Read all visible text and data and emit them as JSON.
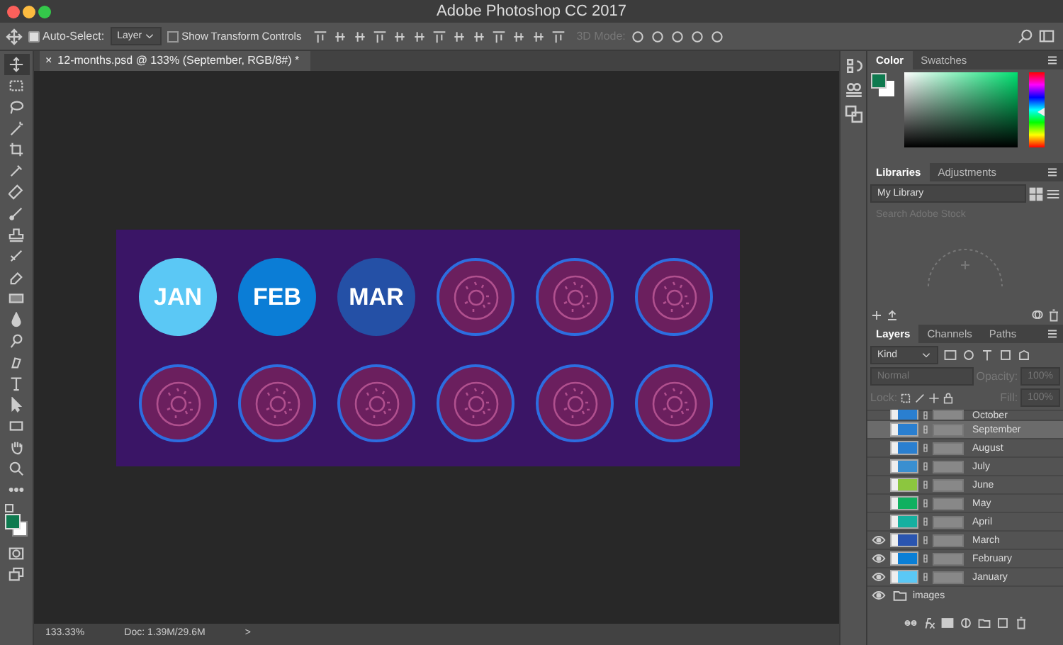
{
  "window": {
    "title": "Adobe Photoshop CC 2017"
  },
  "options_bar": {
    "auto_select": {
      "label": "Auto-Select:",
      "checked": true
    },
    "target": "Layer",
    "show_transform_controls": {
      "label": "Show Transform Controls",
      "checked": false
    },
    "mode_3d": "3D Mode:"
  },
  "document_tab": {
    "close": "×",
    "title": "12-months.psd @ 133% (September, RGB/8#) *"
  },
  "artboard": {
    "circles": [
      {
        "kind": "month",
        "text": "JAN",
        "color": "#5bc8f5"
      },
      {
        "kind": "month",
        "text": "FEB",
        "color": "#0b7dd6"
      },
      {
        "kind": "month",
        "text": "MAR",
        "color": "#2450a6"
      },
      {
        "kind": "donut",
        "color": "#6b1f5e"
      },
      {
        "kind": "donut",
        "color": "#6b1f5e"
      },
      {
        "kind": "donut",
        "color": "#6b1f5e"
      },
      {
        "kind": "donut",
        "color": "#6b1f5e"
      },
      {
        "kind": "donut",
        "color": "#6b1f5e"
      },
      {
        "kind": "donut",
        "color": "#6b1f5e"
      },
      {
        "kind": "donut",
        "color": "#6b1f5e"
      },
      {
        "kind": "donut",
        "color": "#6b1f5e"
      },
      {
        "kind": "donut",
        "color": "#6b1f5e"
      }
    ]
  },
  "status_bar": {
    "zoom": "133.33%",
    "doc": "Doc: 1.39M/29.6M",
    "arrow": ">"
  },
  "color_panel": {
    "tabs": [
      {
        "label": "Color",
        "selected": true
      },
      {
        "label": "Swatches",
        "selected": false
      }
    ]
  },
  "libraries_panel": {
    "tabs": [
      {
        "label": "Libraries",
        "selected": true
      },
      {
        "label": "Adjustments",
        "selected": false
      }
    ],
    "library": "My Library",
    "search": {
      "placeholder": "Search Adobe Stock"
    }
  },
  "layers_panel": {
    "tabs": [
      {
        "label": "Layers",
        "selected": true
      },
      {
        "label": "Channels",
        "selected": false
      },
      {
        "label": "Paths",
        "selected": false
      }
    ],
    "filter": "Kind",
    "blend_mode": "Normal",
    "opacity_label": "Opacity:",
    "opacity": "100%",
    "lock_label": "Lock:",
    "fill_label": "Fill:",
    "fill": "100%",
    "layers": [
      {
        "name": "October",
        "kind": "layer",
        "color": "#2a7fd0",
        "visible": false,
        "selected": false
      },
      {
        "name": "September",
        "kind": "layer",
        "color": "#2a7fd0",
        "visible": false,
        "selected": true
      },
      {
        "name": "August",
        "kind": "layer",
        "color": "#2a7fd0",
        "visible": false,
        "selected": false
      },
      {
        "name": "July",
        "kind": "layer",
        "color": "#3a8fd0",
        "visible": false,
        "selected": false
      },
      {
        "name": "June",
        "kind": "layer",
        "color": "#8cc63f",
        "visible": false,
        "selected": false
      },
      {
        "name": "May",
        "kind": "layer",
        "color": "#10b060",
        "visible": false,
        "selected": false
      },
      {
        "name": "April",
        "kind": "layer",
        "color": "#15b0a0",
        "visible": false,
        "selected": false
      },
      {
        "name": "March",
        "kind": "layer",
        "color": "#2a55b0",
        "visible": true,
        "selected": false
      },
      {
        "name": "February",
        "kind": "layer",
        "color": "#0a7fd6",
        "visible": true,
        "selected": false
      },
      {
        "name": "January",
        "kind": "layer",
        "color": "#5bc8f5",
        "visible": true,
        "selected": false
      },
      {
        "name": "images",
        "kind": "group",
        "visible": true,
        "selected": false
      }
    ]
  }
}
